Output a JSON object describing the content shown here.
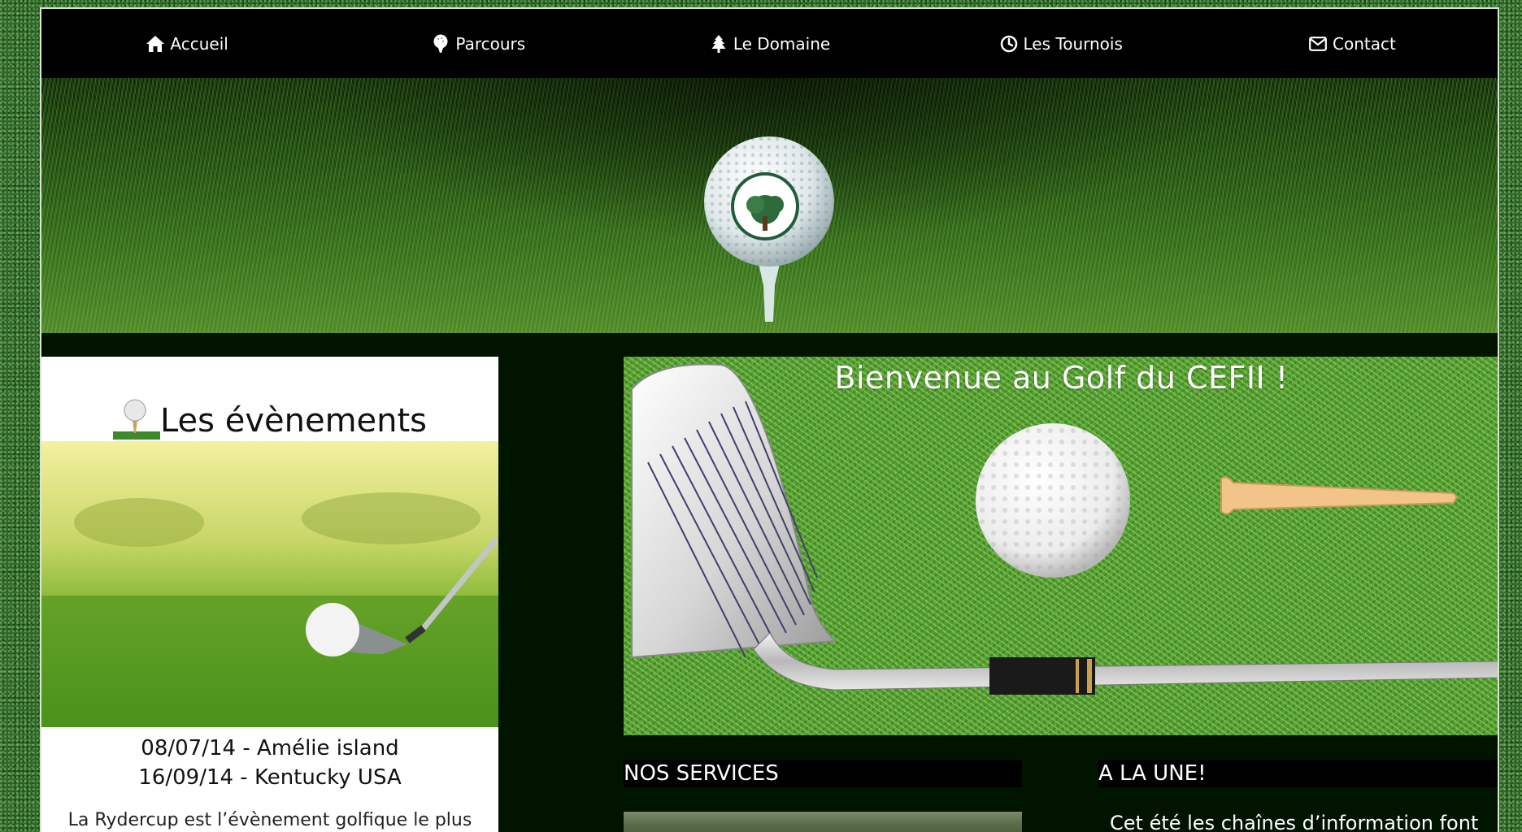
{
  "nav": {
    "items": [
      {
        "label": "Accueil",
        "icon": "home-icon"
      },
      {
        "label": "Parcours",
        "icon": "golf-ball-icon"
      },
      {
        "label": "Le Domaine",
        "icon": "tree-icon"
      },
      {
        "label": "Les Tournois",
        "icon": "clock-icon"
      },
      {
        "label": "Contact",
        "icon": "envelope-icon"
      }
    ]
  },
  "events": {
    "title": "Les évènements",
    "dates": [
      "08/07/14 - Amélie island",
      "16/09/14 - Kentucky USA"
    ],
    "text": "La Rydercup est l’évènement golfique le plus"
  },
  "welcome": {
    "title": "Bienvenue au Golf du CEFII !"
  },
  "services": {
    "title": "NOS SERVICES"
  },
  "une": {
    "title": "A LA UNE!",
    "text": "Cet été les chaînes d’information font"
  },
  "colors": {
    "nav_bg": "#000000",
    "page_bg": "#001400",
    "card_bg": "#ffffff",
    "text_light": "#ffffff"
  }
}
